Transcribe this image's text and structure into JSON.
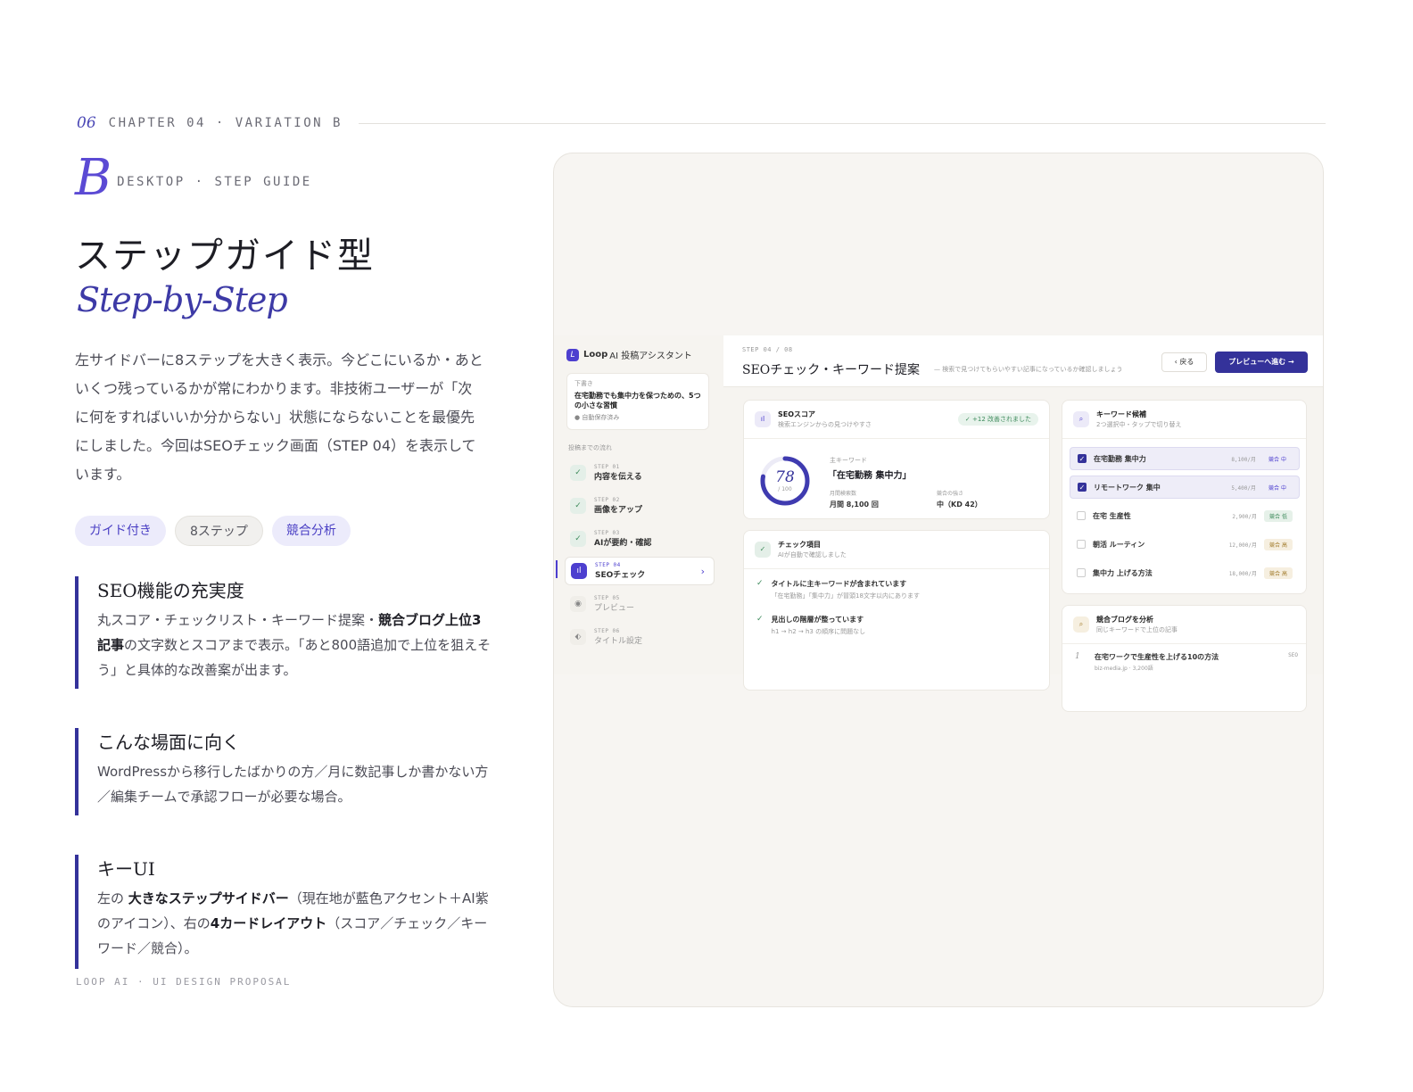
{
  "header": {
    "chapter_num": "06",
    "chapter_label": "CHAPTER 04 · VARIATION B"
  },
  "badge": {
    "letter": "B",
    "label": "DESKTOP · STEP GUIDE"
  },
  "title_jp": "ステップガイド型",
  "title_en": "Step-by-Step",
  "description": "左サイドバーに8ステップを大きく表示。今どこにいるか・あといくつ残っているかが常にわかります。非技術ユーザーが「次に何をすればいいか分からない」状態にならないことを最優先にしました。今回はSEOチェック画面（STEP 04）を表示しています。",
  "tags": [
    "ガイド付き",
    "8ステップ",
    "競合分析"
  ],
  "features": [
    {
      "title": "SEO機能の充実度",
      "p1": "丸スコア・チェックリスト・キーワード提案・",
      "b1": "競合ブログ上位3記事",
      "p2": "の文字数とスコアまで表示。「あと800語追加で上位を狙えそう」と具体的な改善案が出ます。"
    },
    {
      "title": "こんな場面に向く",
      "text": "WordPressから移行したばかりの方／月に数記事しか書かない方／編集チームで承認フローが必要な場合。"
    },
    {
      "title": "キーUI",
      "p1": "左の ",
      "b1": "大きなステップサイドバー",
      "p2": "（現在地が藍色アクセント＋AI紫のアイコン）、右の",
      "b2": "4カードレイアウト",
      "p3": "（スコア／チェック／キーワード／競合）。"
    }
  ],
  "footer": "LOOP AI · UI DESIGN PROPOSAL",
  "app": {
    "brand_logo": "L",
    "brand_name": "Loop",
    "brand_rest": "AI 投稿アシスタント",
    "draft": {
      "label": "下書き",
      "title": "在宅勤務でも集中力を保つための、5つの小さな習慣",
      "status": "● 自動保存済み"
    },
    "flow_label": "投稿までの流れ",
    "steps": [
      {
        "num": "STEP 01",
        "label": "内容を伝える",
        "icon": "✓"
      },
      {
        "num": "STEP 02",
        "label": "画像をアップ",
        "icon": "✓"
      },
      {
        "num": "STEP 03",
        "label": "AIが要約・確認",
        "icon": "✓"
      },
      {
        "num": "STEP 04",
        "label": "SEOチェック",
        "icon": "ıl",
        "chevron": "›"
      },
      {
        "num": "STEP 05",
        "label": "プレビュー",
        "icon": "◉"
      },
      {
        "num": "STEP 06",
        "label": "タイトル設定",
        "icon": "⬖"
      }
    ],
    "topbar": {
      "step_count": "STEP 04 / 08",
      "title": "SEOチェック・キーワード提案",
      "subtitle": "— 検索で見つけてもらいやすい記事になっているか確認しましょう",
      "back": "‹ 戻る",
      "next": "プレビューへ進む →"
    },
    "score": {
      "title": "SEOスコア",
      "subtitle": "検索エンジンからの見つけやすさ",
      "improve": "✓ +12 改善されました",
      "value": "78",
      "max": "/ 100",
      "fraction": 0.78,
      "kw_label": "主キーワード",
      "kw_main": "「在宅勤務 集中力」",
      "vol_label": "月間検索数",
      "vol_val": "月間 8,100 回",
      "cmp_label": "競合の強さ",
      "cmp_val": "中（KD 42）"
    },
    "check": {
      "title": "チェック項目",
      "subtitle": "AIが自動で確認しました",
      "items": [
        {
          "t": "タイトルに主キーワードが含まれています",
          "d": "「在宅勤務」「集中力」が冒頭18文字以内にあります"
        },
        {
          "t": "見出しの階層が整っています",
          "d": "h1 → h2 → h3 の順序に問題なし"
        }
      ]
    },
    "keywords": {
      "title": "キーワード候補",
      "subtitle": "2つ選択中・タップで切り替え",
      "items": [
        {
          "name": "在宅勤務 集中力",
          "vol": "8,100/月",
          "lvl": "競合 中"
        },
        {
          "name": "リモートワーク 集中",
          "vol": "5,400/月",
          "lvl": "競合 中"
        },
        {
          "name": "在宅 生産性",
          "vol": "2,900/月",
          "lvl": "競合 低"
        },
        {
          "name": "朝活 ルーティン",
          "vol": "12,000/月",
          "lvl": "競合 高"
        },
        {
          "name": "集中力 上げる方法",
          "vol": "18,000/月",
          "lvl": "競合 高"
        }
      ]
    },
    "competition": {
      "title": "競合ブログを分析",
      "subtitle": "同じキーワードで上位の記事",
      "item": {
        "rank": "1",
        "t": "在宅ワークで生産性を上げる10の方法",
        "d": "biz-media.jp · 3,200語",
        "tag": "SEO"
      }
    }
  }
}
